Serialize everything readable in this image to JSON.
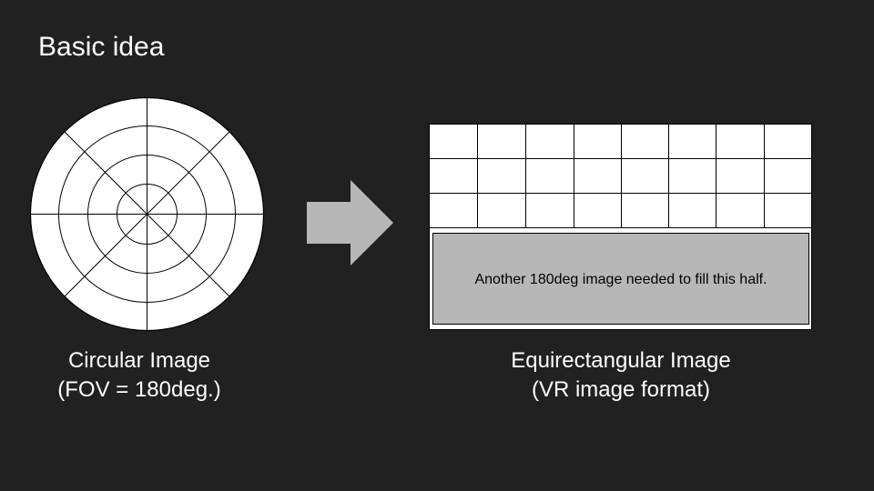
{
  "slide": {
    "title": "Basic idea"
  },
  "circular_image": {
    "caption_line1": "Circular Image",
    "caption_line2": "(FOV = 180deg.)"
  },
  "arrow": {
    "icon": "right-arrow-icon",
    "color": "#b7b7b7"
  },
  "equirect_image": {
    "caption_line1": "Equirectangular Image",
    "caption_line2": "(VR image format)",
    "placeholder_text": "Another 180deg image needed to fill this half.",
    "placeholder_color": "#b7b7b7"
  },
  "colors": {
    "background": "#212121",
    "text": "#ffffff"
  }
}
